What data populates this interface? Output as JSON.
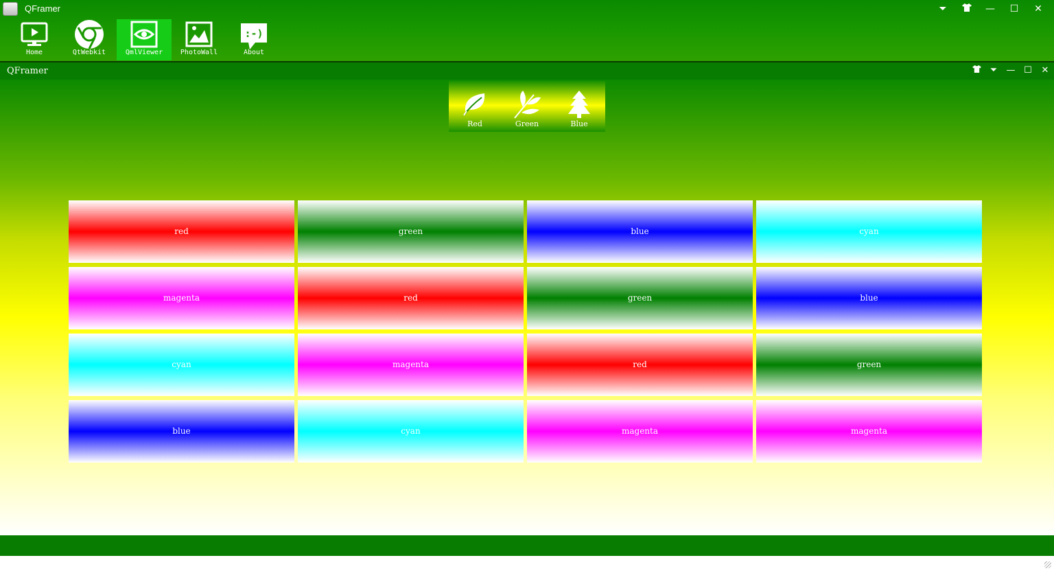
{
  "window": {
    "title": "QFramer",
    "controls": [
      "⏷",
      "👕",
      "—",
      "☐",
      "✕"
    ]
  },
  "nav": {
    "items": [
      {
        "label": "Home",
        "icon": "monitor-play-icon"
      },
      {
        "label": "QtWebkit",
        "icon": "browser-globe-icon"
      },
      {
        "label": "QmlViewer",
        "icon": "eye-icon"
      },
      {
        "label": "PhotoWall",
        "icon": "picture-icon"
      },
      {
        "label": "About",
        "icon": "smiley-speech-icon"
      }
    ],
    "active": "QmlViewer"
  },
  "inner": {
    "title": "QFramer",
    "controls": [
      "👕",
      "⏷",
      "—",
      "☐",
      "✕"
    ]
  },
  "tabs": [
    {
      "label": "Red",
      "icon": "leaf-icon"
    },
    {
      "label": "Green",
      "icon": "branch-leaves-icon"
    },
    {
      "label": "Blue",
      "icon": "tree-icon"
    }
  ],
  "grid": [
    {
      "label": "red",
      "color": "#ff0000"
    },
    {
      "label": "green",
      "color": "#008000"
    },
    {
      "label": "blue",
      "color": "#0000ff"
    },
    {
      "label": "cyan",
      "color": "#00ffff"
    },
    {
      "label": "magenta",
      "color": "#ff00ff"
    },
    {
      "label": "red",
      "color": "#ff0000"
    },
    {
      "label": "green",
      "color": "#008000"
    },
    {
      "label": "blue",
      "color": "#0000ff"
    },
    {
      "label": "cyan",
      "color": "#00ffff"
    },
    {
      "label": "magenta",
      "color": "#ff00ff"
    },
    {
      "label": "red",
      "color": "#ff0000"
    },
    {
      "label": "green",
      "color": "#008000"
    },
    {
      "label": "blue",
      "color": "#0000ff"
    },
    {
      "label": "cyan",
      "color": "#00ffff"
    },
    {
      "label": "magenta",
      "color": "#ff00ff"
    },
    {
      "label": "magenta",
      "color": "#ff00ff"
    }
  ],
  "colors": {
    "top_green": "#0a8a00",
    "active_nav": "#16cc16",
    "bar_green": "#087c00",
    "yellow": "#ffff00"
  }
}
